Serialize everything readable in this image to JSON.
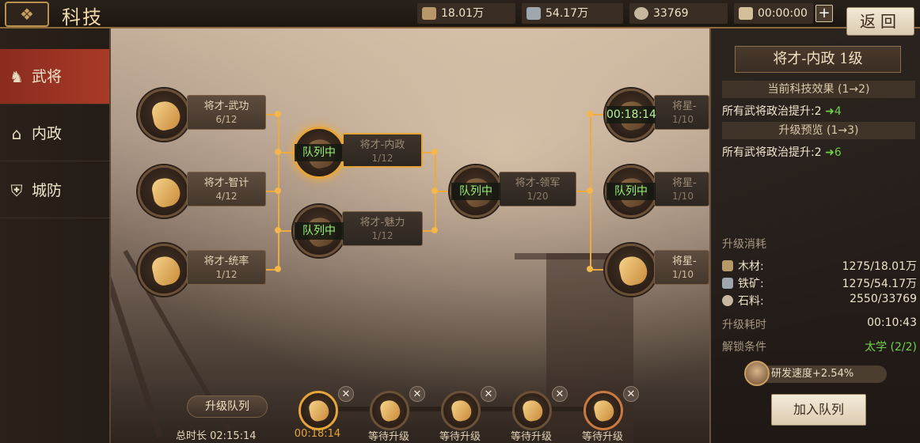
{
  "header": {
    "title": "科技",
    "resources": [
      {
        "name": "wood",
        "icon": "wood-icon",
        "value": "18.01万"
      },
      {
        "name": "iron",
        "icon": "anvil-icon",
        "value": "54.17万"
      },
      {
        "name": "stone",
        "icon": "stone-icon",
        "value": "33769"
      },
      {
        "name": "time",
        "icon": "hourglass-icon",
        "value": "00:00:00"
      }
    ],
    "back_label": "返回"
  },
  "sidebar": {
    "items": [
      {
        "label": "武将",
        "icon": "general-icon",
        "active": true
      },
      {
        "label": "内政",
        "icon": "building-icon",
        "active": false
      },
      {
        "label": "城防",
        "icon": "shield-icon",
        "active": false
      }
    ]
  },
  "tree": {
    "nodes": [
      {
        "name": "将才-武功",
        "level": "6/12",
        "tag": ""
      },
      {
        "name": "将才-智计",
        "level": "4/12",
        "tag": ""
      },
      {
        "name": "将才-统率",
        "level": "1/12",
        "tag": ""
      },
      {
        "name": "将才-内政",
        "level": "1/12",
        "tag": "队列中"
      },
      {
        "name": "将才-魅力",
        "level": "1/12",
        "tag": "队列中"
      },
      {
        "name": "将才-领军",
        "level": "1/20",
        "tag": "队列中"
      },
      {
        "name": "将星-",
        "level": "1/10",
        "tag": "00:18:14"
      },
      {
        "name": "将星-",
        "level": "1/10",
        "tag": "队列中"
      },
      {
        "name": "将星-",
        "level": "1/10",
        "tag": ""
      }
    ]
  },
  "detail": {
    "title": "将才-内政  1级",
    "current_head": "当前科技效果 (1→2)",
    "current_effect": "所有武将政治提升:2",
    "current_value": "4",
    "preview_head": "升级预览 (1→3)",
    "preview_effect": "所有武将政治提升:2",
    "preview_value": "6",
    "cost_head": "升级消耗",
    "costs": [
      {
        "label": "木材:",
        "icon": "wood-icon",
        "value": "1275/18.01万"
      },
      {
        "label": "铁矿:",
        "icon": "anvil-icon",
        "value": "1275/54.17万"
      },
      {
        "label": "石料:",
        "icon": "stone-icon",
        "value": "2550/33769"
      }
    ],
    "time_label": "升级耗时",
    "time_value": "00:10:43",
    "unlock_label": "解锁条件",
    "unlock_value": "太学 (2/2)",
    "speed_text": "研发速度+2.54%",
    "join_label": "加入队列"
  },
  "queue": {
    "label": "升级队列",
    "total": "总时长 02:15:14",
    "slots": [
      {
        "status": "00:18:14"
      },
      {
        "status": "等待升级"
      },
      {
        "status": "等待升级"
      },
      {
        "status": "等待升级"
      },
      {
        "status": "等待升级"
      }
    ],
    "close_glyph": "✕"
  }
}
